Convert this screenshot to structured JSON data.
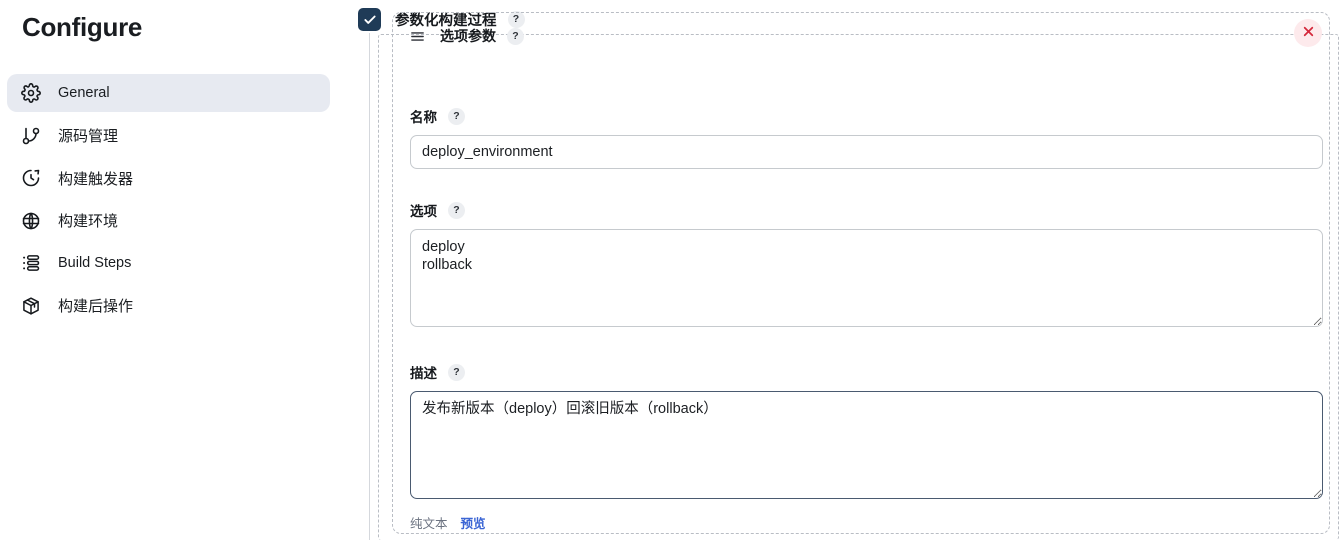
{
  "sidebar": {
    "title": "Configure",
    "items": [
      {
        "label": "General",
        "icon": "gear-icon",
        "active": true
      },
      {
        "label": "源码管理",
        "icon": "git-branch-icon",
        "active": false
      },
      {
        "label": "构建触发器",
        "icon": "clock-timer-icon",
        "active": false
      },
      {
        "label": "构建环境",
        "icon": "globe-icon",
        "active": false
      },
      {
        "label": "Build Steps",
        "icon": "list-ordered-icon",
        "active": false
      },
      {
        "label": "构建后操作",
        "icon": "package-box-icon",
        "active": false
      }
    ]
  },
  "parameterized_build": {
    "label": "参数化构建过程",
    "checked": true,
    "checkbox_icon": "check-icon",
    "help_label": "?",
    "checkbox_color": "#1f3b57"
  },
  "parameter_block": {
    "drag_handle_icon": "hamburger-drag-handle-icon",
    "title": "选项参数",
    "help_label": "?",
    "close_icon": "close-x-icon",
    "close_color": "#d4283b",
    "close_bg": "#fdeaec",
    "fields": {
      "name": {
        "label": "名称",
        "help_label": "?",
        "value": "deploy_environment",
        "placeholder": ""
      },
      "options": {
        "label": "选项",
        "help_label": "?",
        "value": "deploy\nrollback",
        "placeholder": "",
        "resize_handle_icon": "resize-handle-icon"
      },
      "description": {
        "label": "描述",
        "help_label": "?",
        "value": "发布新版本（deploy）回滚旧版本（rollback）",
        "placeholder": "",
        "focused": true,
        "resize_handle_icon": "resize-handle-icon"
      }
    },
    "description_footer": {
      "plain_text_label": "纯文本",
      "preview_label": "预览",
      "preview_color": "#3b65d4"
    }
  },
  "theme": {
    "accent_link": "#3b65d4",
    "active_nav_bg": "#e7eaf1",
    "dashed_border": "#b9bdc4",
    "input_border": "#c6cace",
    "text_primary": "#16191d",
    "text_muted": "#6b7280"
  }
}
